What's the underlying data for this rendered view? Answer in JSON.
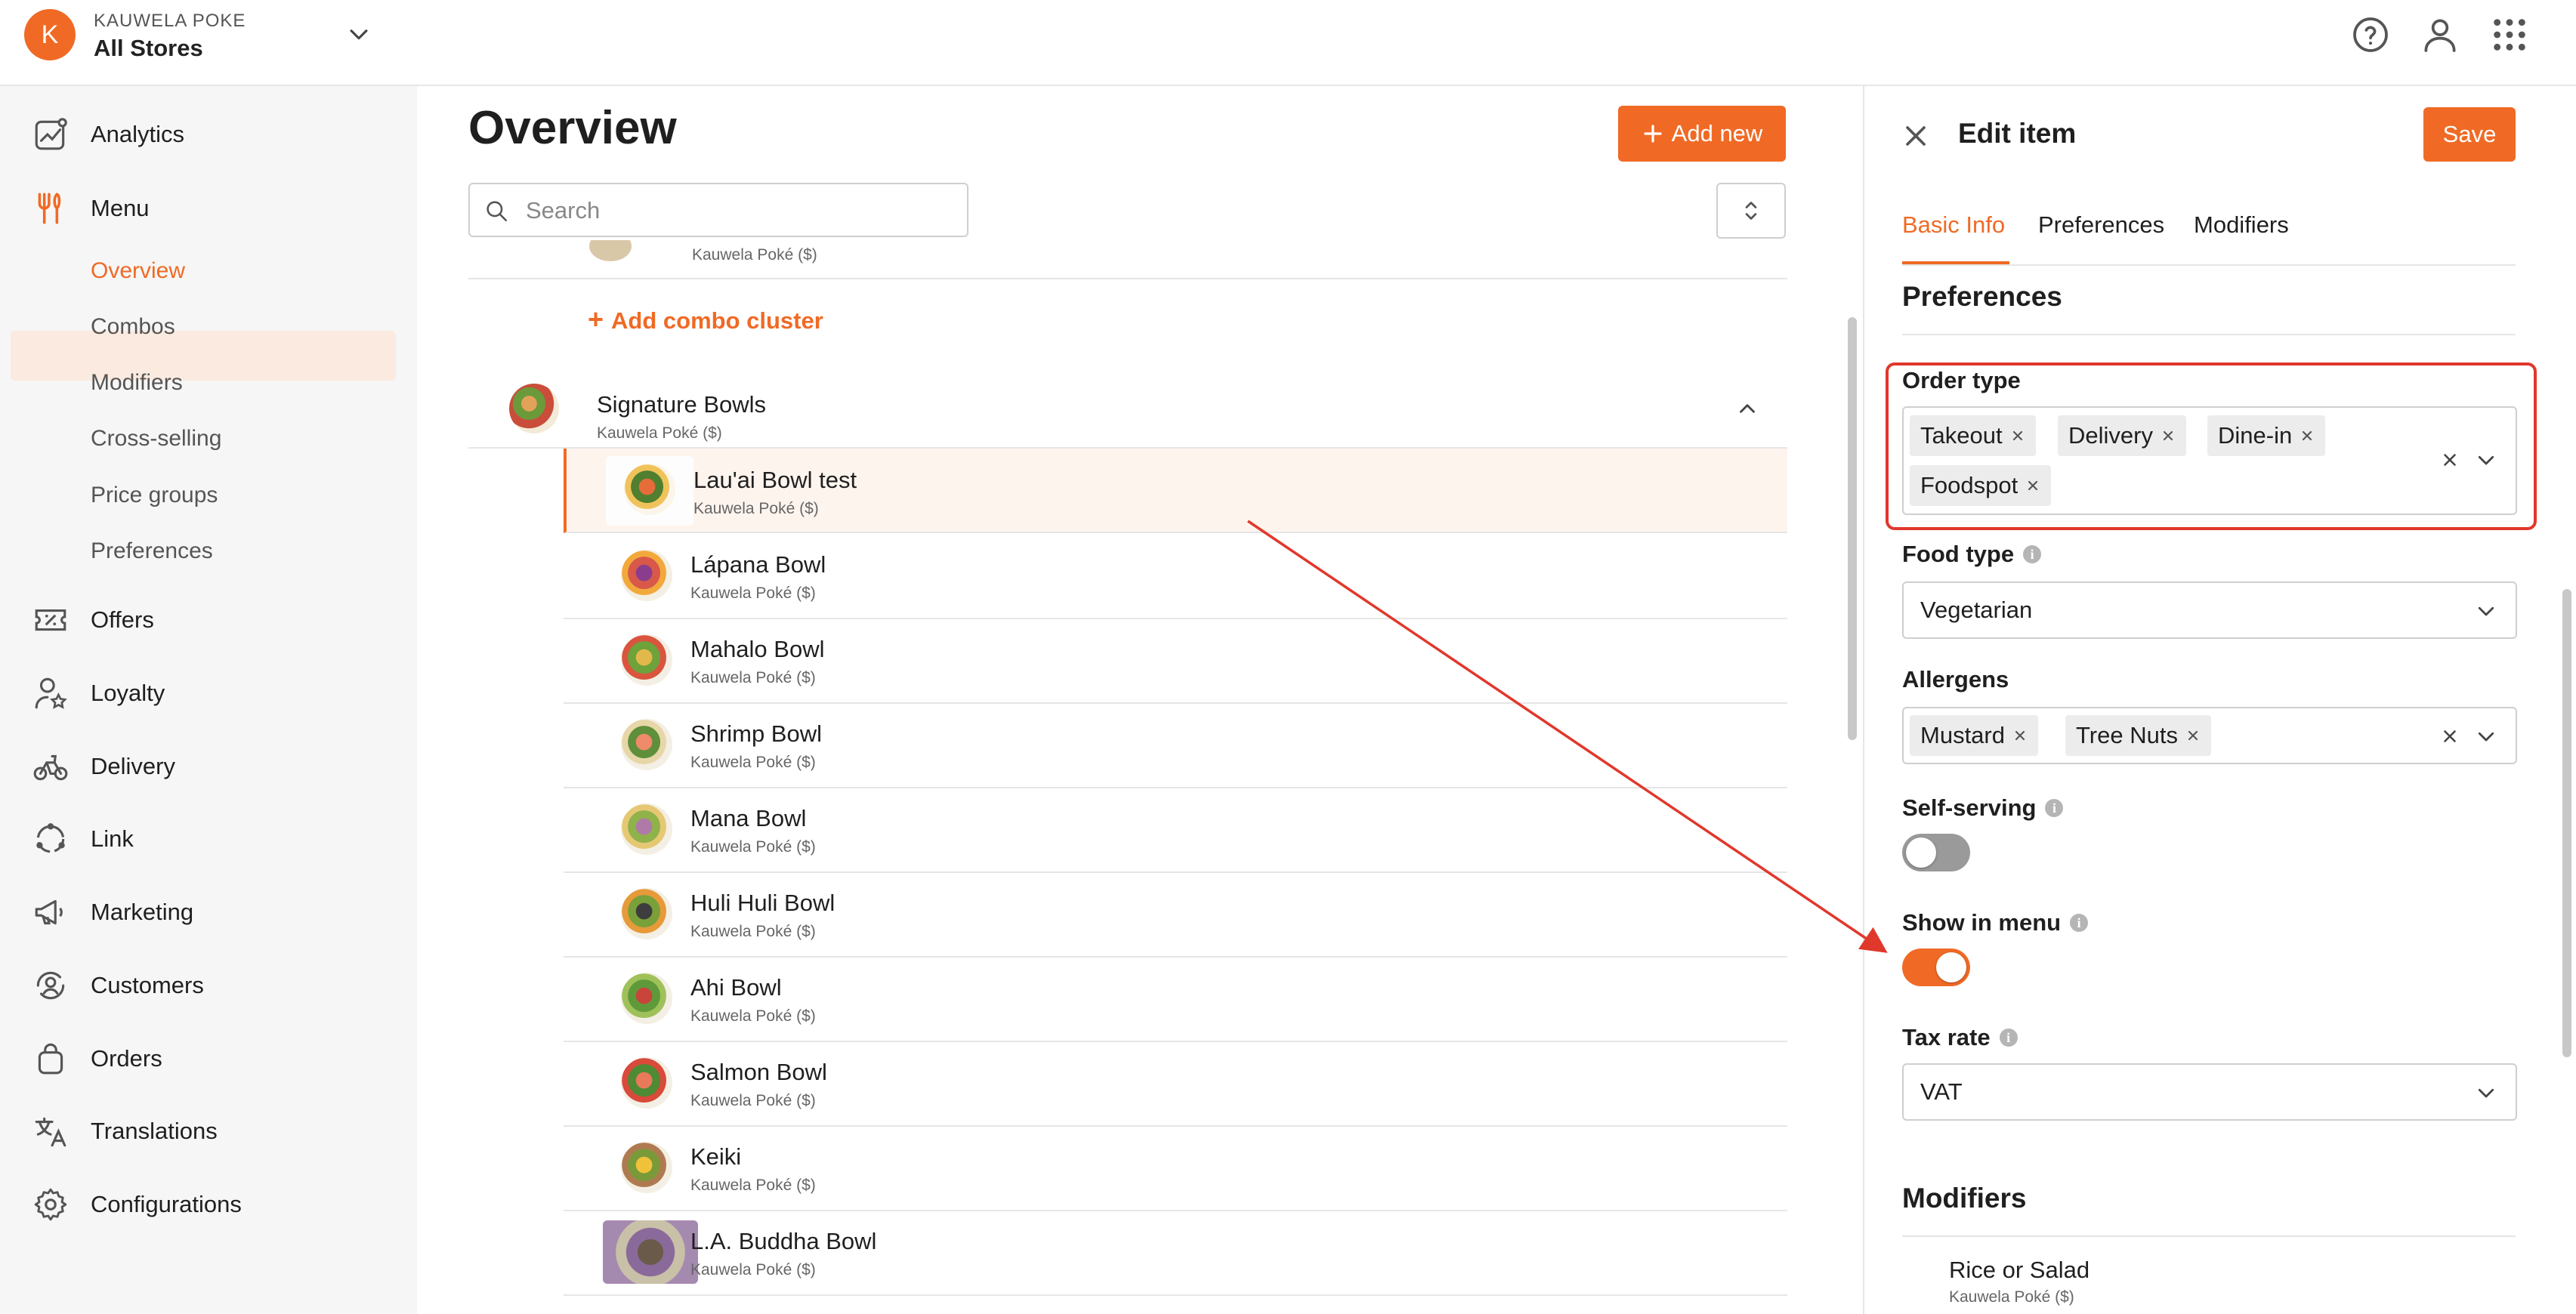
{
  "brand": {
    "org": "KAUWELA POKE",
    "store": "All Stores",
    "initial": "K"
  },
  "sidebar": {
    "items": [
      {
        "label": "Analytics"
      },
      {
        "label": "Menu"
      },
      {
        "label": "Offers"
      },
      {
        "label": "Loyalty"
      },
      {
        "label": "Delivery"
      },
      {
        "label": "Link"
      },
      {
        "label": "Marketing"
      },
      {
        "label": "Customers"
      },
      {
        "label": "Orders"
      },
      {
        "label": "Translations"
      },
      {
        "label": "Configurations"
      }
    ],
    "menu_subitems": [
      {
        "label": "Overview"
      },
      {
        "label": "Combos"
      },
      {
        "label": "Modifiers"
      },
      {
        "label": "Cross-selling"
      },
      {
        "label": "Price groups"
      },
      {
        "label": "Preferences"
      }
    ]
  },
  "main": {
    "title": "Overview",
    "add_new": "Add new",
    "search_placeholder": "Search",
    "cut_row_sub": "Kauwela Poké ($)",
    "add_combo_cluster": "Add combo cluster",
    "group": {
      "name": "Signature Bowls",
      "sub": "Kauwela Poké ($)"
    },
    "items": [
      {
        "name": "Lau'ai Bowl test",
        "sub": "Kauwela Poké ($)"
      },
      {
        "name": "Lápana Bowl",
        "sub": "Kauwela Poké ($)"
      },
      {
        "name": "Mahalo Bowl",
        "sub": "Kauwela Poké ($)"
      },
      {
        "name": "Shrimp Bowl",
        "sub": "Kauwela Poké ($)"
      },
      {
        "name": "Mana Bowl",
        "sub": "Kauwela Poké ($)"
      },
      {
        "name": "Huli Huli Bowl",
        "sub": "Kauwela Poké ($)"
      },
      {
        "name": "Ahi Bowl",
        "sub": "Kauwela Poké ($)"
      },
      {
        "name": "Salmon Bowl",
        "sub": "Kauwela Poké ($)"
      },
      {
        "name": "Keiki",
        "sub": "Kauwela Poké ($)"
      },
      {
        "name": "L.A. Buddha Bowl",
        "sub": "Kauwela Poké ($)"
      }
    ]
  },
  "panel": {
    "title": "Edit item",
    "save": "Save",
    "tabs": [
      {
        "label": "Basic Info"
      },
      {
        "label": "Preferences"
      },
      {
        "label": "Modifiers"
      }
    ],
    "preferences_heading": "Preferences",
    "order_type": {
      "label": "Order type",
      "chips": [
        "Takeout",
        "Delivery",
        "Dine-in",
        "Foodspot"
      ]
    },
    "food_type": {
      "label": "Food type",
      "value": "Vegetarian"
    },
    "allergens": {
      "label": "Allergens",
      "chips": [
        "Mustard",
        "Tree Nuts"
      ]
    },
    "self_serving": {
      "label": "Self-serving",
      "on": false
    },
    "show_in_menu": {
      "label": "Show in menu",
      "on": true
    },
    "tax_rate": {
      "label": "Tax rate",
      "value": "VAT"
    },
    "modifiers_heading": "Modifiers",
    "modifier_item": {
      "name": "Rice or Salad",
      "sub": "Kauwela Poké ($)"
    }
  },
  "colors": {
    "accent": "#f06a25",
    "annotation": "#e0382c",
    "sidebar_bg": "#f6f6f6",
    "active_row": "#fef4ee"
  }
}
